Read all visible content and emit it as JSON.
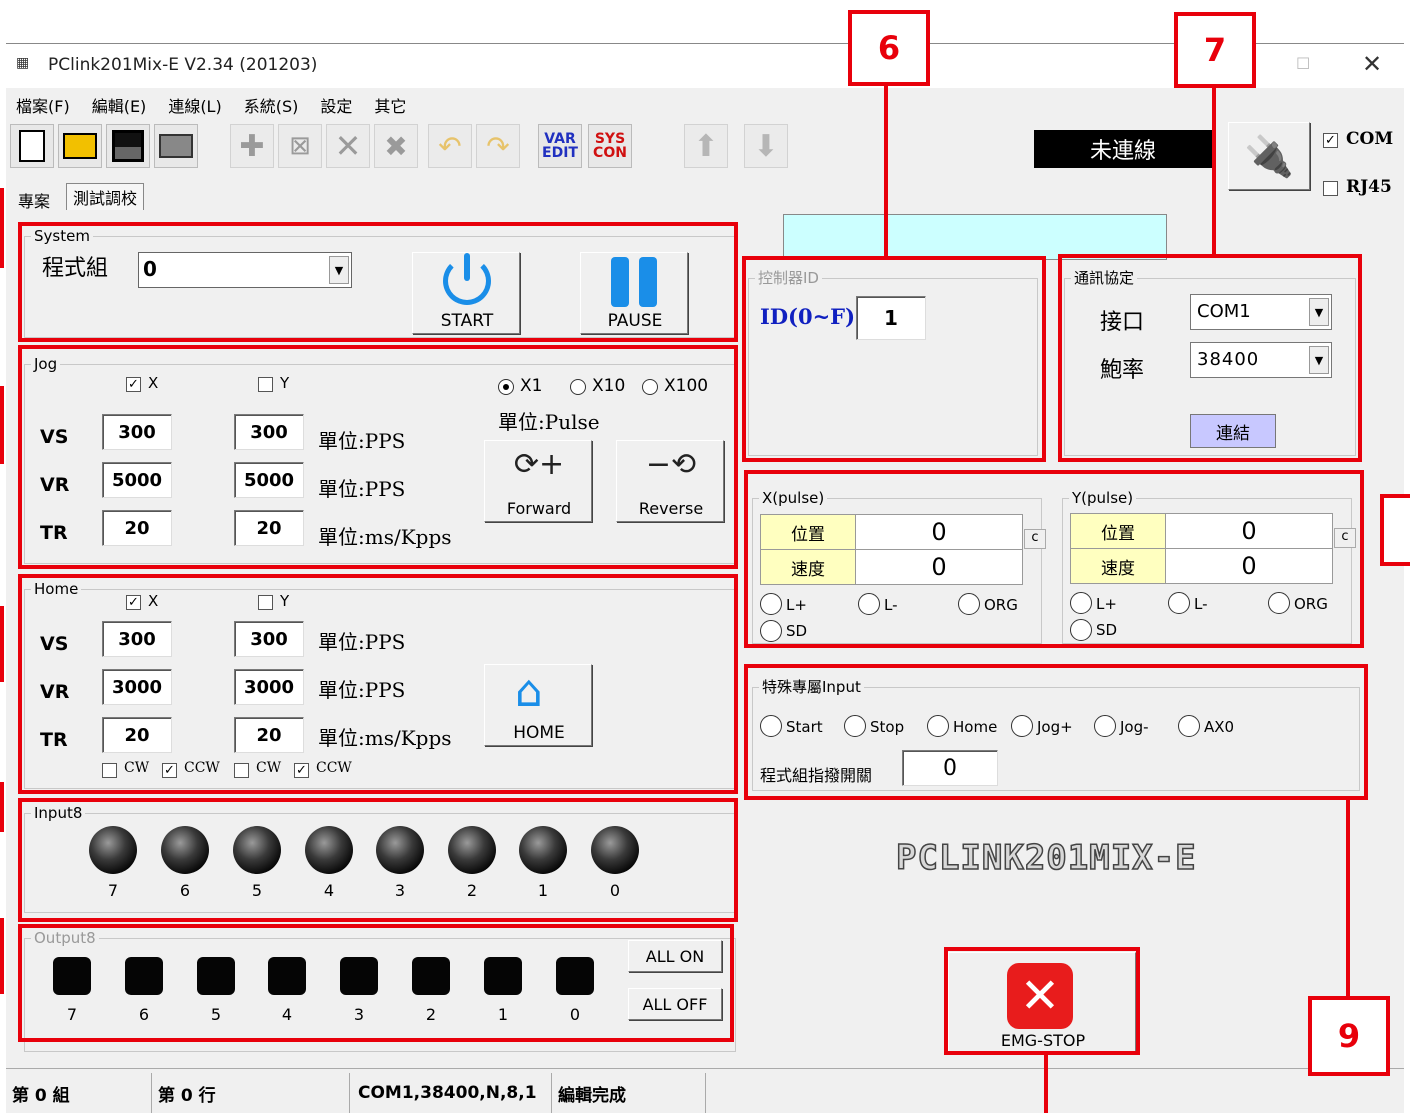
{
  "window": {
    "title": "PClink201Mix-E V2.34 (201203)"
  },
  "menu": [
    "檔案(F)",
    "編輯(E)",
    "連線(L)",
    "系統(S)",
    "設定",
    "其它"
  ],
  "toolbar": {
    "var_line1": "VAR",
    "var_line2": "EDIT",
    "sys_line1": "SYS",
    "sys_line2": "CON"
  },
  "connection": {
    "status": "未連線",
    "com_label": "COM",
    "com_checked": true,
    "rj45_label": "RJ45",
    "rj45_checked": false
  },
  "tabs": [
    "專案",
    "測試調校"
  ],
  "system": {
    "title": "System",
    "program_label": "程式組",
    "program_value": "0",
    "start_label": "START",
    "pause_label": "PAUSE"
  },
  "jog": {
    "title": "Jog",
    "x_label": "X",
    "y_label": "Y",
    "rate_options": [
      "X1",
      "X10",
      "X100"
    ],
    "rate_selected": "X1",
    "unit_pulse": "單位:Pulse",
    "rows": [
      {
        "label": "VS",
        "x": "300",
        "y": "300",
        "unit": "單位:PPS"
      },
      {
        "label": "VR",
        "x": "5000",
        "y": "5000",
        "unit": "單位:PPS"
      },
      {
        "label": "TR",
        "x": "20",
        "y": "20",
        "unit": "單位:ms/Kpps"
      }
    ],
    "forward_label": "Forward",
    "reverse_label": "Reverse"
  },
  "home": {
    "title": "Home",
    "x_label": "X",
    "y_label": "Y",
    "rows": [
      {
        "label": "VS",
        "x": "300",
        "y": "300",
        "unit": "單位:PPS"
      },
      {
        "label": "VR",
        "x": "3000",
        "y": "3000",
        "unit": "單位:PPS"
      },
      {
        "label": "TR",
        "x": "20",
        "y": "20",
        "unit": "單位:ms/Kpps"
      }
    ],
    "dirs": [
      "CW",
      "CCW",
      "CW",
      "CCW"
    ],
    "home_label": "HOME"
  },
  "input8": {
    "title": "Input8",
    "labels": [
      "7",
      "6",
      "5",
      "4",
      "3",
      "2",
      "1",
      "0"
    ]
  },
  "output8": {
    "title": "Output8",
    "labels": [
      "7",
      "6",
      "5",
      "4",
      "3",
      "2",
      "1",
      "0"
    ],
    "all_on": "ALL ON",
    "all_off": "ALL OFF"
  },
  "controller": {
    "title": "控制器ID",
    "id_label": "ID(0~F)",
    "id_value": "1"
  },
  "protocol": {
    "title": "通訊協定",
    "port_label": "接口",
    "port_value": "COM1",
    "baud_label": "鮑率",
    "baud_value": "38400",
    "connect_label": "連結"
  },
  "xaxis": {
    "title": "X(pulse)",
    "pos_label": "位置",
    "pos_value": "0",
    "spd_label": "速度",
    "spd_value": "0",
    "c": "c",
    "l_plus": "L+",
    "l_minus": "L-",
    "org": "ORG",
    "sd": "SD"
  },
  "yaxis": {
    "title": "Y(pulse)",
    "pos_label": "位置",
    "pos_value": "0",
    "spd_label": "速度",
    "spd_value": "0",
    "c": "c",
    "l_plus": "L+",
    "l_minus": "L-",
    "org": "ORG",
    "sd": "SD"
  },
  "special": {
    "title": "特殊專屬Input",
    "inputs": [
      "Start",
      "Stop",
      "Home",
      "Jog+",
      "Jog-",
      "AX0"
    ],
    "switch_label": "程式組指撥開關",
    "switch_value": "0"
  },
  "logo": "PCLINK201MIX-E",
  "emg_label": "EMG-STOP",
  "statusbar": [
    "第 0 組",
    "第 0 行",
    "COM1,38400,N,8,1",
    "編輯完成"
  ],
  "callouts": [
    "6",
    "7",
    "9"
  ],
  "colors": {
    "annotation_red": "#e8000b",
    "lcd_cyan": "#ccffff",
    "label_yellow": "#ffffc0",
    "connect_button": "#c8c8ff"
  }
}
